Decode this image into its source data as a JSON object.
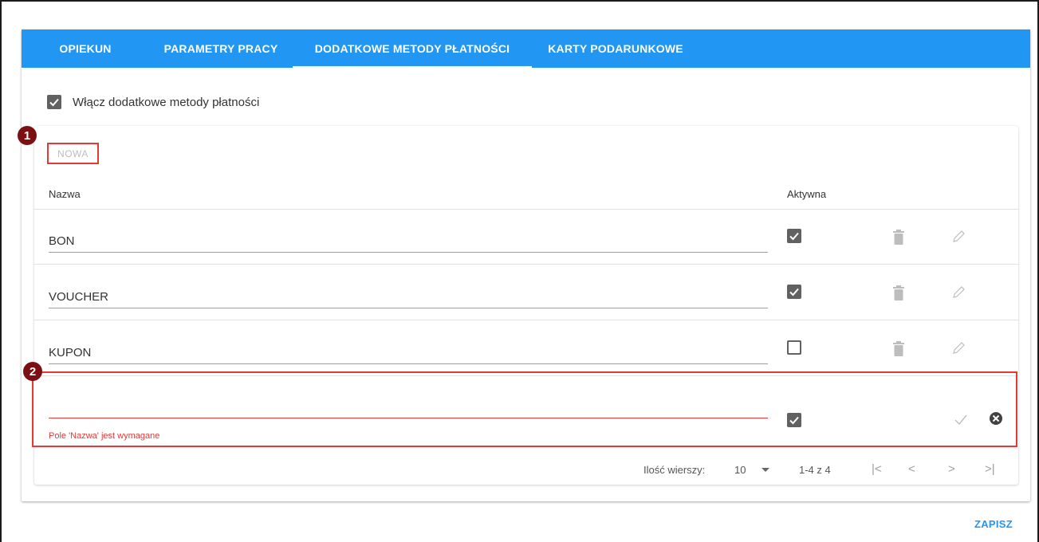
{
  "tabs": [
    {
      "label": "OPIEKUN"
    },
    {
      "label": "PARAMETRY PRACY"
    },
    {
      "label": "DODATKOWE METODY PŁATNOŚCI"
    },
    {
      "label": "KARTY PODARUNKOWE"
    }
  ],
  "enable": {
    "label": "Włącz dodatkowe metody płatności",
    "checked": true
  },
  "toolbar": {
    "new_label": "NOWA"
  },
  "badges": {
    "one": "1",
    "two": "2"
  },
  "table": {
    "headers": {
      "name": "Nazwa",
      "active": "Aktywna"
    },
    "rows": [
      {
        "name": "BON",
        "active": true
      },
      {
        "name": "VOUCHER",
        "active": true
      },
      {
        "name": "KUPON",
        "active": false
      }
    ],
    "new_row": {
      "name": "",
      "active": true,
      "error": "Pole 'Nazwa' jest wymagane"
    }
  },
  "pager": {
    "rows_label": "Ilość wierszy:",
    "rows_value": "10",
    "range": "1-4 z 4"
  },
  "actions": {
    "save_label": "ZAPISZ"
  },
  "colors": {
    "tab_bar": "#2196f3",
    "highlight": "#e53935",
    "badge": "#7b0f12",
    "checkbox": "#616161"
  }
}
